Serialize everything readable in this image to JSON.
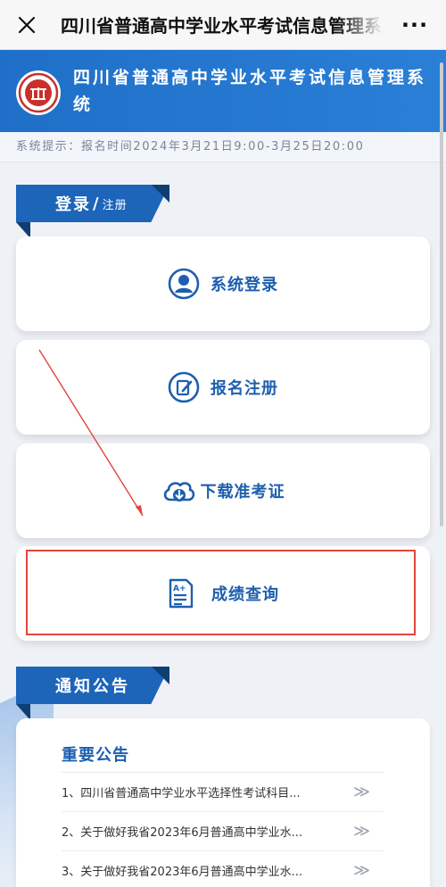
{
  "browser": {
    "title": "四川省普通高中学业水平考试信息管理系统",
    "more": "···"
  },
  "header": {
    "title": "四川省普通高中学业水平考试信息管理系统"
  },
  "notice": {
    "text": "系统提示：报名时间2024年3月21日9:00-3月25日20:00"
  },
  "login_section": {
    "title": "登录",
    "divider": "/",
    "subtitle": "注册"
  },
  "menu": {
    "login": "系统登录",
    "register": "报名注册",
    "download": "下载准考证",
    "scores": "成绩查询"
  },
  "notices_section": {
    "title": "通知公告"
  },
  "announcements": {
    "title": "重要公告",
    "items": [
      {
        "text": "1、四川省普通高中学业水平选择性考试科目..."
      },
      {
        "text": "2、关于做好我省2023年6月普通高中学业水..."
      },
      {
        "text": "3、关于做好我省2023年6月普通高中学业水..."
      }
    ],
    "chevron": "≫"
  },
  "colors": {
    "brand_blue": "#1f6fc8",
    "tag_blue": "#1d65b8",
    "icon_blue": "#1d5fae",
    "highlight_red": "#e0463c"
  }
}
